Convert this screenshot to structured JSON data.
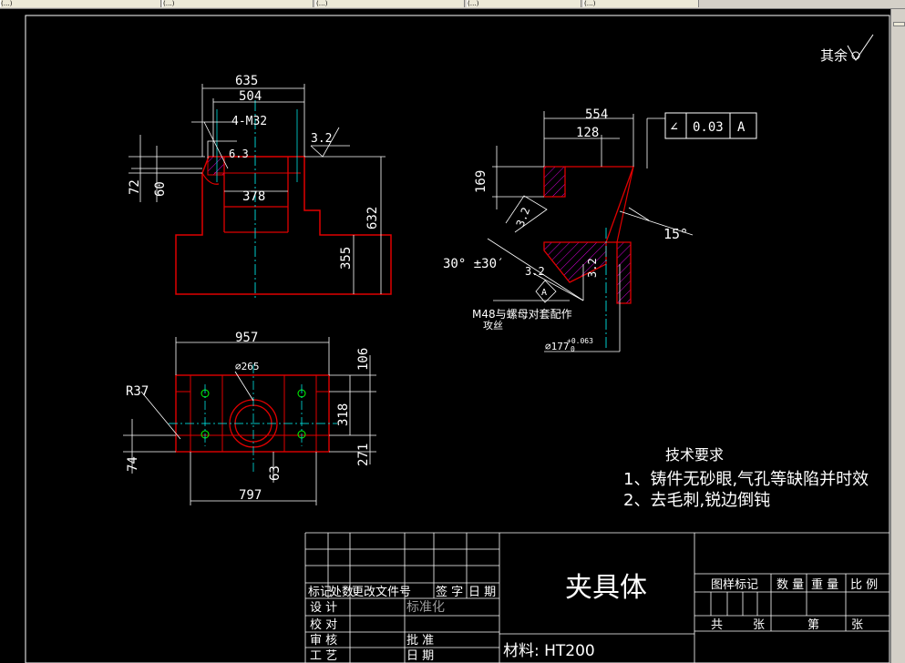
{
  "app": {
    "tabs": [
      "(…)",
      "(…)",
      "(…)",
      "(…)",
      "(…)"
    ]
  },
  "drawing": {
    "title": "夹具体",
    "material": "材料: HT200",
    "surface_note": "其余",
    "tech_title": "技术要求",
    "tech_1": "1、铸件无砂眼,气孔等缺陷并时效",
    "tech_2": "2、去毛刺,锐边倒钝",
    "dims_front": {
      "d635": "635",
      "d504": "504",
      "hole": "4-M32",
      "d378": "378",
      "d72": "72",
      "d60": "60",
      "d632": "632",
      "d355": "355",
      "r32": "3.2",
      "r63": "6.3"
    },
    "dims_side": {
      "d554": "554",
      "d128": "128",
      "d169": "169",
      "angle15": "15°",
      "angle30": "30° ±30′",
      "r32a": "3.2",
      "r32b": "3.2",
      "r32c": "3.2",
      "thread": "M48与螺母对套配作",
      "thread2": "攻丝",
      "diam": "⌀177",
      "tol": "+0.063",
      "tol0": "0",
      "datum": "A"
    },
    "tolerance_frame": {
      "symbol": "∠",
      "value": "0.03",
      "datum": "A"
    },
    "dims_top": {
      "d957": "957",
      "d797": "797",
      "d265": "⌀265",
      "r37": "R37",
      "d74": "74",
      "d63": "63",
      "d106": "106",
      "d318": "318",
      "d271": "271"
    },
    "title_block": {
      "row_labels": [
        "标记",
        "处数",
        "更改文件号",
        "签 字",
        "日 期"
      ],
      "design": "设 计",
      "standard": "标准化",
      "check": "校 对",
      "review": "审 核",
      "approve": "批 准",
      "craft": "工 艺",
      "date": "日 期",
      "stage": "图样标记",
      "qty": "数 量",
      "weight": "重 量",
      "scale": "比 例",
      "total": "共",
      "sheets": "张",
      "sheet_no": "第",
      "sheet_unit": "张"
    }
  }
}
